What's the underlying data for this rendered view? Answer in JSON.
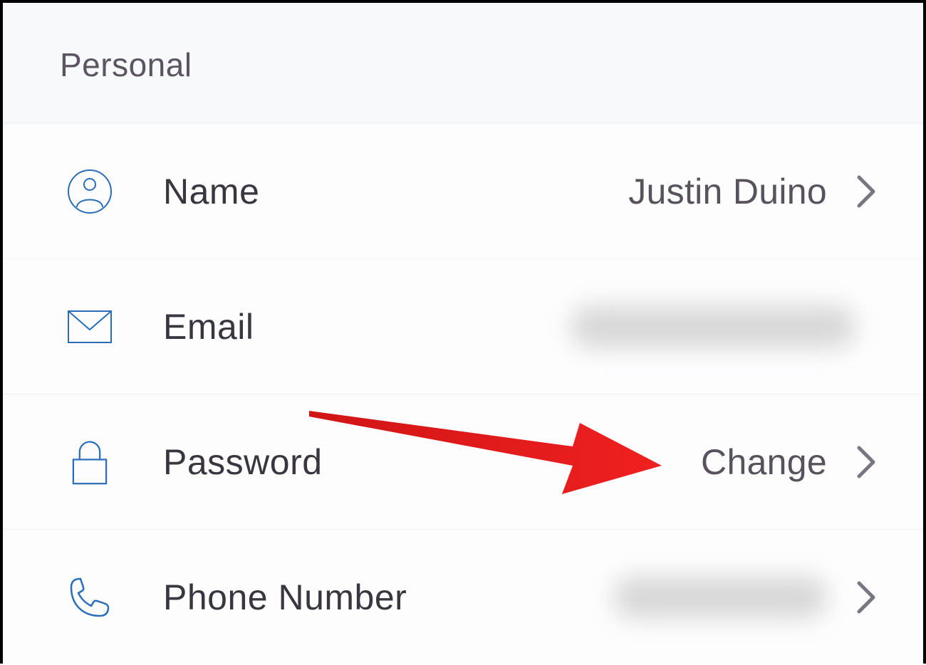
{
  "section": {
    "title": "Personal"
  },
  "items": [
    {
      "icon": "person-icon",
      "label": "Name",
      "value": "Justin Duino",
      "blurred": false,
      "has_chevron": true
    },
    {
      "icon": "envelope-icon",
      "label": "Email",
      "value": "",
      "blurred": true,
      "has_chevron": false
    },
    {
      "icon": "lock-icon",
      "label": "Password",
      "value": "Change",
      "blurred": false,
      "has_chevron": true
    },
    {
      "icon": "phone-icon",
      "label": "Phone Number",
      "value": "",
      "blurred": true,
      "has_chevron": true
    }
  ],
  "colors": {
    "icon_stroke": "#2a6db8",
    "chevron_stroke": "#7a7580",
    "arrow_fill": "#e21b1b"
  }
}
